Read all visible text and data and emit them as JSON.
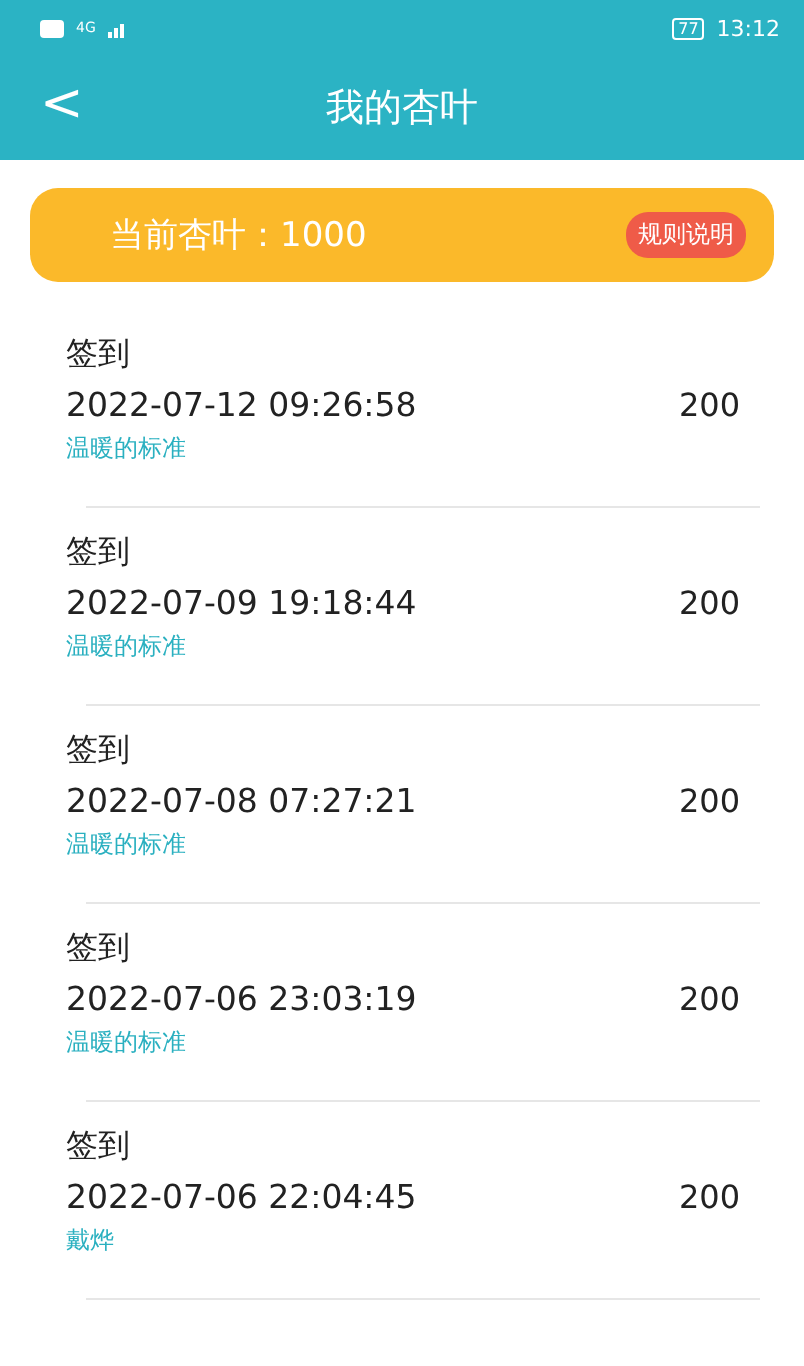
{
  "status_bar": {
    "network": "4G",
    "time": "13:12",
    "battery": "77"
  },
  "header": {
    "back": "<",
    "title": "我的杏叶"
  },
  "balance": {
    "label": "当前杏叶：1000",
    "rules_button": "规则说明"
  },
  "records": [
    {
      "title": "签到",
      "time": "2022-07-12 09:26:58",
      "amount": "200",
      "note": "温暖的标准"
    },
    {
      "title": "签到",
      "time": "2022-07-09 19:18:44",
      "amount": "200",
      "note": "温暖的标准"
    },
    {
      "title": "签到",
      "time": "2022-07-08 07:27:21",
      "amount": "200",
      "note": "温暖的标准"
    },
    {
      "title": "签到",
      "time": "2022-07-06 23:03:19",
      "amount": "200",
      "note": "温暖的标准"
    },
    {
      "title": "签到",
      "time": "2022-07-06 22:04:45",
      "amount": "200",
      "note": "戴烨"
    }
  ]
}
